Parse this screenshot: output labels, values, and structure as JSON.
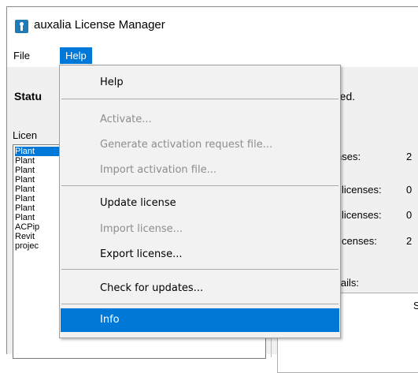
{
  "window": {
    "title": "auxalia License Manager",
    "app_icon": "key-icon"
  },
  "menubar": {
    "file_label": "File",
    "help_label": "Help"
  },
  "status": {
    "label": "Statu",
    "tail": "ated."
  },
  "licenses_label": "Licen",
  "license_list": [
    "Plant",
    "Plant",
    "Plant",
    "Plant",
    "Plant",
    "Plant",
    "Plant",
    "Plant",
    "ACPip",
    "Revit",
    "projec"
  ],
  "stats": [
    {
      "label": "nses:",
      "value": "2"
    },
    {
      "label": "licenses:",
      "value": "0"
    },
    {
      "label": "licenses:",
      "value": "0"
    },
    {
      "label": "censes:",
      "value": "2"
    }
  ],
  "details": {
    "label": "etails:",
    "column_header": "S"
  },
  "help_menu": {
    "items": [
      {
        "label": "Help",
        "enabled": true
      },
      {
        "label": "Activate...",
        "enabled": false
      },
      {
        "label": "Generate activation request file...",
        "enabled": false
      },
      {
        "label": "Import activation file...",
        "enabled": false
      },
      {
        "label": "Update license",
        "enabled": true
      },
      {
        "label": "Import license...",
        "enabled": false
      },
      {
        "label": "Export license...",
        "enabled": true
      },
      {
        "label": "Check for updates...",
        "enabled": true
      },
      {
        "label": "Info",
        "enabled": true,
        "highlighted": true
      }
    ]
  },
  "colors": {
    "accent": "#0078d7",
    "disabled_text": "#8d8d8d",
    "menu_bg": "#f2f2f2"
  }
}
